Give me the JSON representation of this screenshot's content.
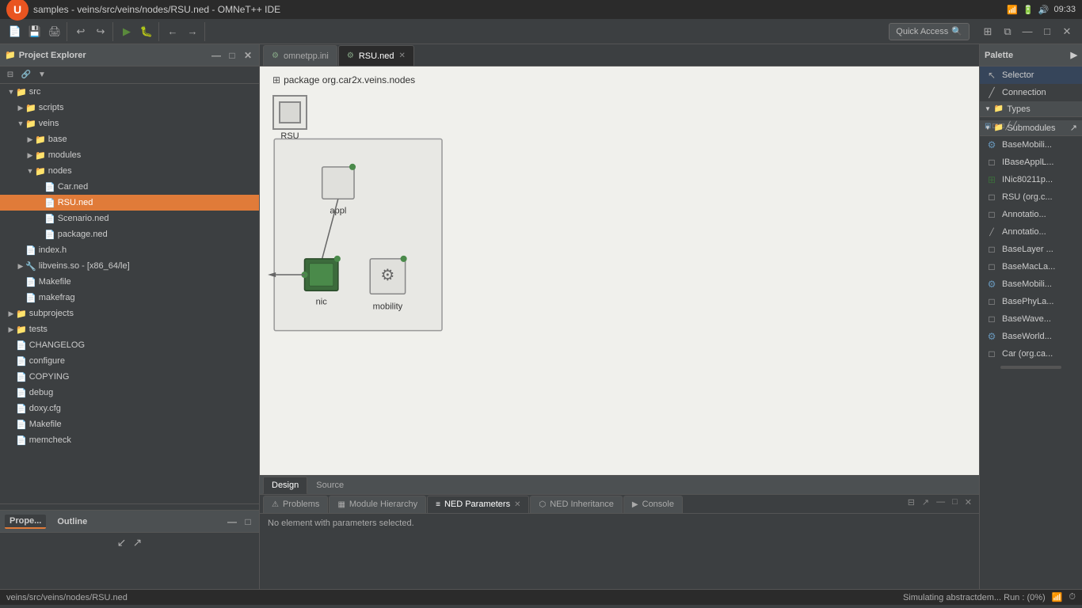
{
  "titlebar": {
    "title": "samples - veins/src/veins/nodes/RSU.ned - OMNeT++ IDE",
    "time": "09:33",
    "os_icon": "ubuntu"
  },
  "toolbar": {
    "quick_access_label": "Quick Access",
    "groups": [
      "file",
      "edit",
      "run",
      "debug",
      "navigate"
    ]
  },
  "project_explorer": {
    "title": "Project Explorer",
    "tree": [
      {
        "id": "src",
        "label": "src",
        "level": 1,
        "type": "folder",
        "expanded": true
      },
      {
        "id": "scripts",
        "label": "scripts",
        "level": 2,
        "type": "folder",
        "expanded": false
      },
      {
        "id": "veins",
        "label": "veins",
        "level": 2,
        "type": "folder",
        "expanded": true
      },
      {
        "id": "base",
        "label": "base",
        "level": 3,
        "type": "folder",
        "expanded": false
      },
      {
        "id": "modules",
        "label": "modules",
        "level": 3,
        "type": "folder",
        "expanded": false
      },
      {
        "id": "nodes",
        "label": "nodes",
        "level": 3,
        "type": "folder",
        "expanded": true
      },
      {
        "id": "Car.ned",
        "label": "Car.ned",
        "level": 4,
        "type": "ned",
        "expanded": false
      },
      {
        "id": "RSU.ned",
        "label": "RSU.ned",
        "level": 4,
        "type": "ned",
        "expanded": false,
        "selected": true
      },
      {
        "id": "Scenario.ned",
        "label": "Scenario.ned",
        "level": 4,
        "type": "ned",
        "expanded": false
      },
      {
        "id": "package.ned",
        "label": "package.ned",
        "level": 4,
        "type": "ned",
        "expanded": false
      },
      {
        "id": "index.h",
        "label": "index.h",
        "level": 2,
        "type": "file",
        "expanded": false
      },
      {
        "id": "libveins",
        "label": "libveins.so - [x86_64/le]",
        "level": 2,
        "type": "lib",
        "expanded": false
      },
      {
        "id": "Makefile",
        "label": "Makefile",
        "level": 2,
        "type": "file",
        "expanded": false
      },
      {
        "id": "makefrag",
        "label": "makefrag",
        "level": 2,
        "type": "file",
        "expanded": false
      },
      {
        "id": "subprojects",
        "label": "subprojects",
        "level": 1,
        "type": "folder",
        "expanded": false
      },
      {
        "id": "tests",
        "label": "tests",
        "level": 1,
        "type": "folder",
        "expanded": false
      },
      {
        "id": "CHANGELOG",
        "label": "CHANGELOG",
        "level": 1,
        "type": "file",
        "expanded": false
      },
      {
        "id": "configure",
        "label": "configure",
        "level": 1,
        "type": "file",
        "expanded": false
      },
      {
        "id": "COPYING",
        "label": "COPYING",
        "level": 1,
        "type": "file",
        "expanded": false
      },
      {
        "id": "debug",
        "label": "debug",
        "level": 1,
        "type": "file",
        "expanded": false
      },
      {
        "id": "doxy.cfg",
        "label": "doxy.cfg",
        "level": 1,
        "type": "file",
        "expanded": false
      },
      {
        "id": "Makefile2",
        "label": "Makefile",
        "level": 1,
        "type": "file",
        "expanded": false
      },
      {
        "id": "memcheck",
        "label": "memcheck",
        "level": 1,
        "type": "file",
        "expanded": false
      }
    ]
  },
  "editor": {
    "tabs": [
      {
        "id": "omnetpp.ini",
        "label": "omnetpp.ini",
        "closable": false,
        "active": false
      },
      {
        "id": "RSU.ned",
        "label": "RSU.ned",
        "closable": true,
        "active": true
      }
    ],
    "package_label": "package org.car2x.veins.nodes",
    "module_name": "RSU",
    "design_tab": "Design",
    "source_tab": "Source"
  },
  "palette": {
    "title": "Palette",
    "selector_label": "Selector",
    "connection_label": "Connection",
    "types_label": "Types",
    "submodules_label": "Submodules",
    "items": [
      "BaseMobili...",
      "IBaseApplL...",
      "INic80211p...",
      "RSU (org.c...",
      "Annotatio...",
      "Annotatio...",
      "BaseLayer ...",
      "BaseMacLa...",
      "BaseMobili...",
      "BasePhyLa...",
      "BaseWave...",
      "BaseWorld...",
      "Car (org.ca..."
    ]
  },
  "bottom_panel": {
    "tabs": [
      {
        "id": "problems",
        "label": "Problems",
        "icon": "⚠"
      },
      {
        "id": "module-hierarchy",
        "label": "Module Hierarchy",
        "icon": "▦"
      },
      {
        "id": "ned-parameters",
        "label": "NED Parameters",
        "icon": "≡",
        "active": true,
        "closable": true
      },
      {
        "id": "ned-inheritance",
        "label": "NED Inheritance",
        "icon": "⬡"
      },
      {
        "id": "console",
        "label": "Console",
        "icon": "▶"
      }
    ],
    "status_text": "No element with parameters selected."
  },
  "properties_panel": {
    "tabs": [
      {
        "id": "properties",
        "label": "Prope..."
      },
      {
        "id": "outline",
        "label": "Outline"
      }
    ]
  },
  "statusbar": {
    "left": "veins/src/veins/nodes/RSU.ned",
    "right_progress": "Simulating abstractdem...",
    "right_run": "Run : (0%)"
  }
}
